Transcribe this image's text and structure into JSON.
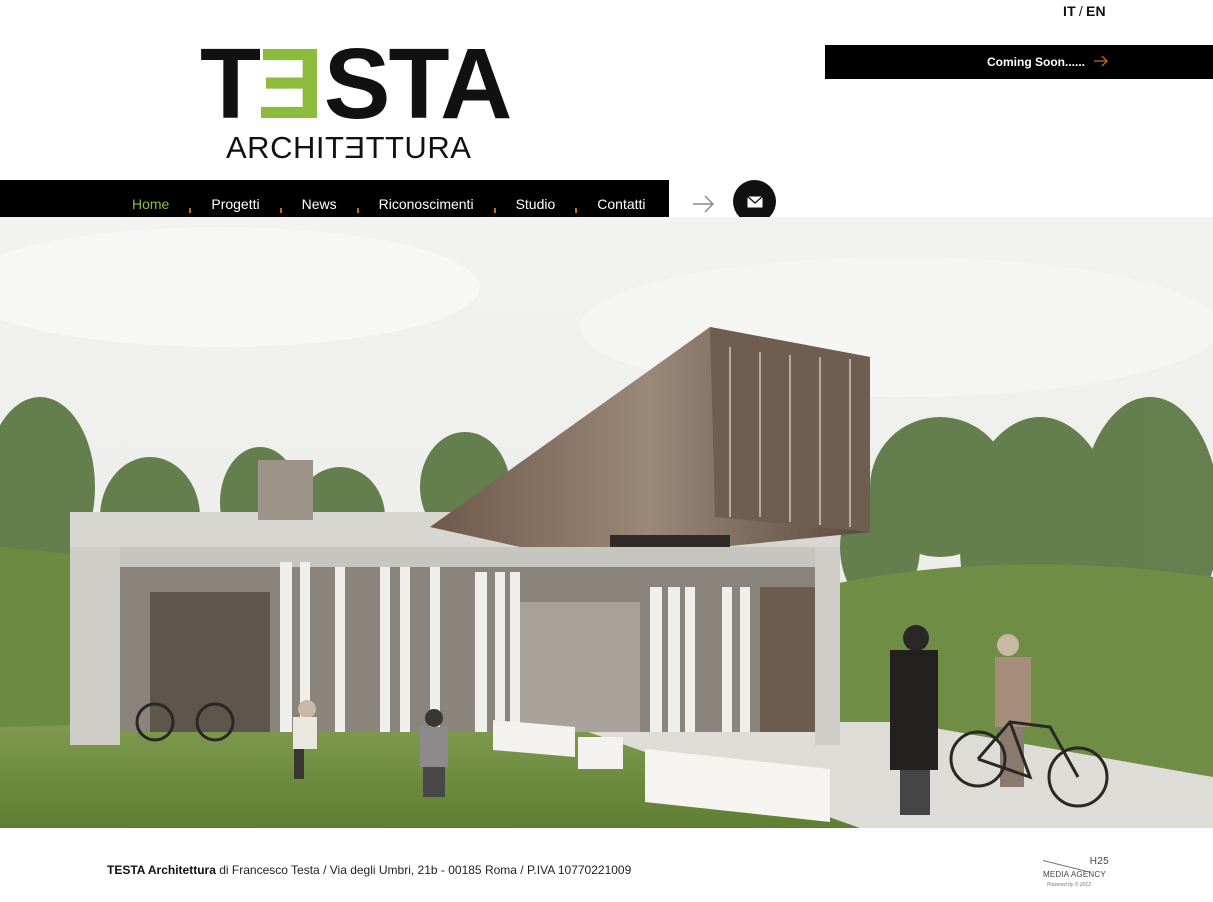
{
  "lang": {
    "it": "IT",
    "separator": "/",
    "en": "EN"
  },
  "coming_soon": {
    "label": "Coming Soon......"
  },
  "logo": {
    "word_prefix": "T",
    "word_e": "E",
    "word_suffix": "STA",
    "subtitle": "ARCHITƎTTURA"
  },
  "nav": {
    "items": [
      {
        "label": "Home",
        "active": true
      },
      {
        "label": "Progetti"
      },
      {
        "label": "News"
      },
      {
        "label": "Riconoscimenti"
      },
      {
        "label": "Studio"
      },
      {
        "label": "Contatti"
      }
    ]
  },
  "icons": {
    "next": "arrow-right-icon",
    "mail": "envelope-icon"
  },
  "footer": {
    "brand": "TESTA Architettura",
    "text": " di Francesco Testa / Via degli Umbri, 21b - 00185 Roma / P.IVA 10770221009"
  },
  "agency": {
    "line1": "H25",
    "line2": "MEDIA AGENCY",
    "line3": "Powered by © 2012"
  },
  "colors": {
    "accent": "#8dbb3b",
    "bar": "#000000",
    "nav_dot": "#c46a1a"
  }
}
